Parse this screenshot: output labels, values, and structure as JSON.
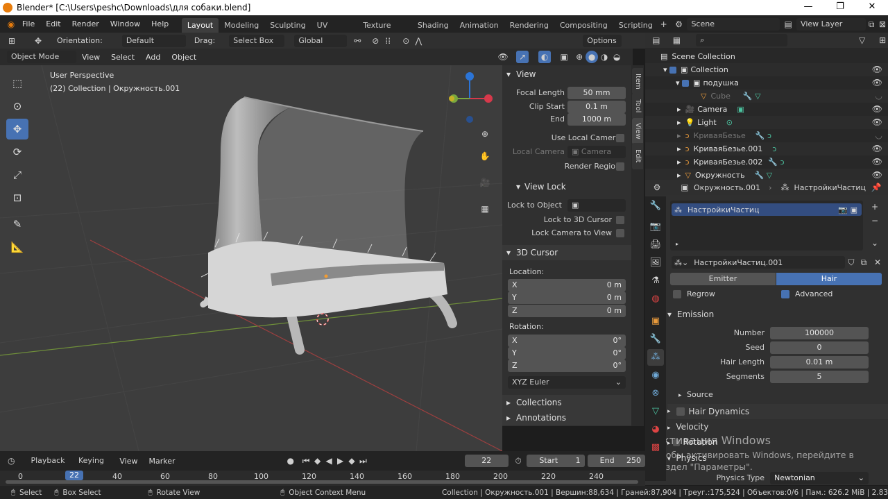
{
  "window": {
    "title": "Blender* [C:\\Users\\peshc\\Downloads\\для собаки.blend]"
  },
  "menu": [
    "File",
    "Edit",
    "Render",
    "Window",
    "Help"
  ],
  "workspaces": [
    "Layout",
    "Modeling",
    "Sculpting",
    "UV Editing",
    "Texture Paint",
    "Shading",
    "Animation",
    "Rendering",
    "Compositing",
    "Scripting"
  ],
  "scene": {
    "label": "Scene",
    "view_layer": "View Layer"
  },
  "tool_header": {
    "orientation_label": "Orientation:",
    "orientation_value": "Default",
    "drag_label": "Drag:",
    "drag_value": "Select Box",
    "transform": "Global",
    "options": "Options"
  },
  "vp_header": {
    "mode": "Object Mode",
    "view": "View",
    "select": "Select",
    "add": "Add",
    "object": "Object"
  },
  "viewport": {
    "perspective": "User Perspective",
    "collection_info": "(22) Collection | Окружность.001"
  },
  "npanel": {
    "tabs": [
      "Item",
      "Tool",
      "View",
      "Edit"
    ],
    "view_section": "View",
    "focal_length_label": "Focal Length",
    "focal_length": "50 mm",
    "clip_start_label": "Clip Start",
    "clip_start": "0.1 m",
    "end_label": "End",
    "end": "1000 m",
    "use_local_camera": "Use Local Camera",
    "local_camera_label": "Local Camera",
    "local_camera": "Camera",
    "render_region": "Render Region",
    "view_lock": "View Lock",
    "lock_to_object": "Lock to Object",
    "lock_to_3d_cursor": "Lock to 3D Cursor",
    "lock_camera_to_view": "Lock Camera to View",
    "cursor_section": "3D Cursor",
    "location_label": "Location:",
    "loc_x_label": "X",
    "loc_x": "0 m",
    "loc_y_label": "Y",
    "loc_y": "0 m",
    "loc_z_label": "Z",
    "loc_z": "0 m",
    "rotation_label": "Rotation:",
    "rot_x_label": "X",
    "rot_x": "0°",
    "rot_y_label": "Y",
    "rot_y": "0°",
    "rot_z_label": "Z",
    "rot_z": "0°",
    "rotation_mode": "XYZ Euler",
    "collections": "Collections",
    "annotations": "Annotations"
  },
  "outliner": {
    "search_placeholder": "",
    "rows": [
      {
        "label": "Scene Collection"
      },
      {
        "label": "Collection"
      },
      {
        "label": "подушка"
      },
      {
        "label": "Cube"
      },
      {
        "label": "Camera"
      },
      {
        "label": "Light"
      },
      {
        "label": "КриваяБезье"
      },
      {
        "label": "КриваяБезье.001"
      },
      {
        "label": "КриваяБезье.002"
      },
      {
        "label": "Окружность"
      }
    ]
  },
  "properties": {
    "object": "Окружность.001",
    "psys": "НастройкиЧастиц",
    "list_item": "НастройкиЧастиц",
    "settings": "НастройкиЧастиц.001",
    "emitter": "Emitter",
    "hair": "Hair",
    "regrow": "Regrow",
    "advanced": "Advanced",
    "emission": "Emission",
    "number_label": "Number",
    "number": "100000",
    "seed_label": "Seed",
    "seed": "0",
    "hair_length_label": "Hair Length",
    "hair_length": "0.01 m",
    "segments_label": "Segments",
    "segments": "5",
    "source": "Source",
    "hair_dynamics": "Hair Dynamics",
    "velocity": "Velocity",
    "rotation": "Rotation",
    "physics": "Physics",
    "physics_type_label": "Physics Type",
    "physics_type": "Newtonian"
  },
  "watermark": {
    "line1": "Активация Windows",
    "line2": "Чтобы активировать Windows, перейдите в",
    "line3": "раздел \"Параметры\"."
  },
  "timeline": {
    "playback": "Playback",
    "keying": "Keying",
    "view": "View",
    "marker": "Marker",
    "current_frame": "22",
    "start_label": "Start",
    "start": "1",
    "end_label": "End",
    "end": "250",
    "ticks": [
      "0",
      "22",
      "40",
      "60",
      "80",
      "100",
      "120",
      "140",
      "160",
      "180",
      "200",
      "220",
      "240"
    ]
  },
  "statusbar": {
    "select": "Select",
    "box_select": "Box Select",
    "rotate_view": "Rotate View",
    "context_menu": "Object Context Menu",
    "stats": "Collection | Окружность.001 | Вершин:88,634 | Граней:87,904 | Треуг.:175,524 | Объектов:0/6 | Пам.: 626.2 МiВ | 2.83"
  }
}
